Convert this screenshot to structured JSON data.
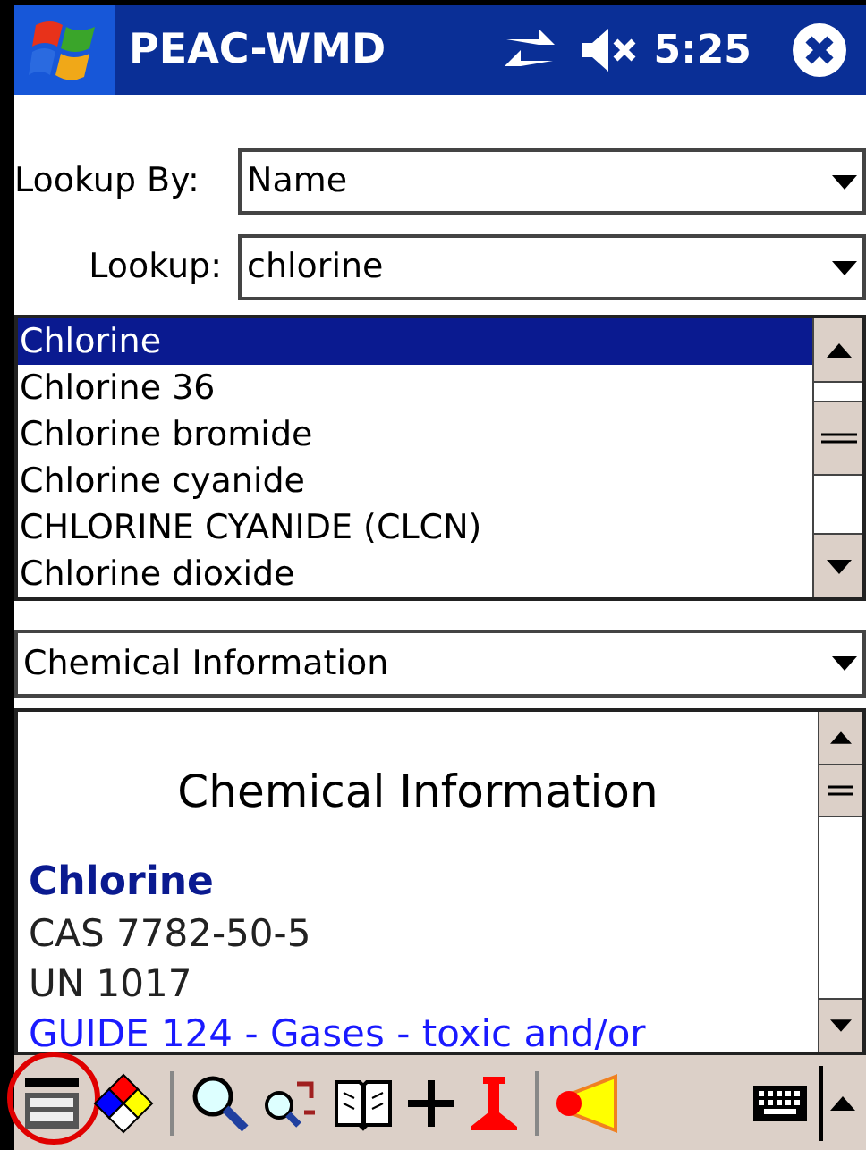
{
  "title_bar": {
    "title": "PEAC-WMD",
    "time": "5:25",
    "sound_muted": true
  },
  "lookup_by": {
    "label": "Lookup By:",
    "value": "Name"
  },
  "lookup": {
    "label": "Lookup:",
    "value": "chlorine"
  },
  "results": [
    {
      "label": "Chlorine",
      "selected": true
    },
    {
      "label": "Chlorine 36",
      "selected": false
    },
    {
      "label": "Chlorine bromide",
      "selected": false
    },
    {
      "label": "Chlorine cyanide",
      "selected": false
    },
    {
      "label": "CHLORINE CYANIDE (CLCN)",
      "selected": false
    },
    {
      "label": "Chlorine dioxide",
      "selected": false
    }
  ],
  "view_select": {
    "value": "Chemical Information"
  },
  "info": {
    "heading": "Chemical Information",
    "name": "Chlorine",
    "cas": "CAS 7782-50-5",
    "un": "UN 1017",
    "guide_link": "GUIDE 124 - Gases - toxic and/or"
  },
  "toolbar": [
    {
      "kind": "list",
      "highlighted": true
    },
    {
      "kind": "diamond",
      "highlighted": false
    },
    {
      "kind": "sep"
    },
    {
      "kind": "search",
      "highlighted": false
    },
    {
      "kind": "search-swap",
      "highlighted": false
    },
    {
      "kind": "book",
      "highlighted": false
    },
    {
      "kind": "plus",
      "highlighted": false
    },
    {
      "kind": "pin",
      "highlighted": false
    },
    {
      "kind": "sep"
    },
    {
      "kind": "plume",
      "highlighted": false
    }
  ]
}
